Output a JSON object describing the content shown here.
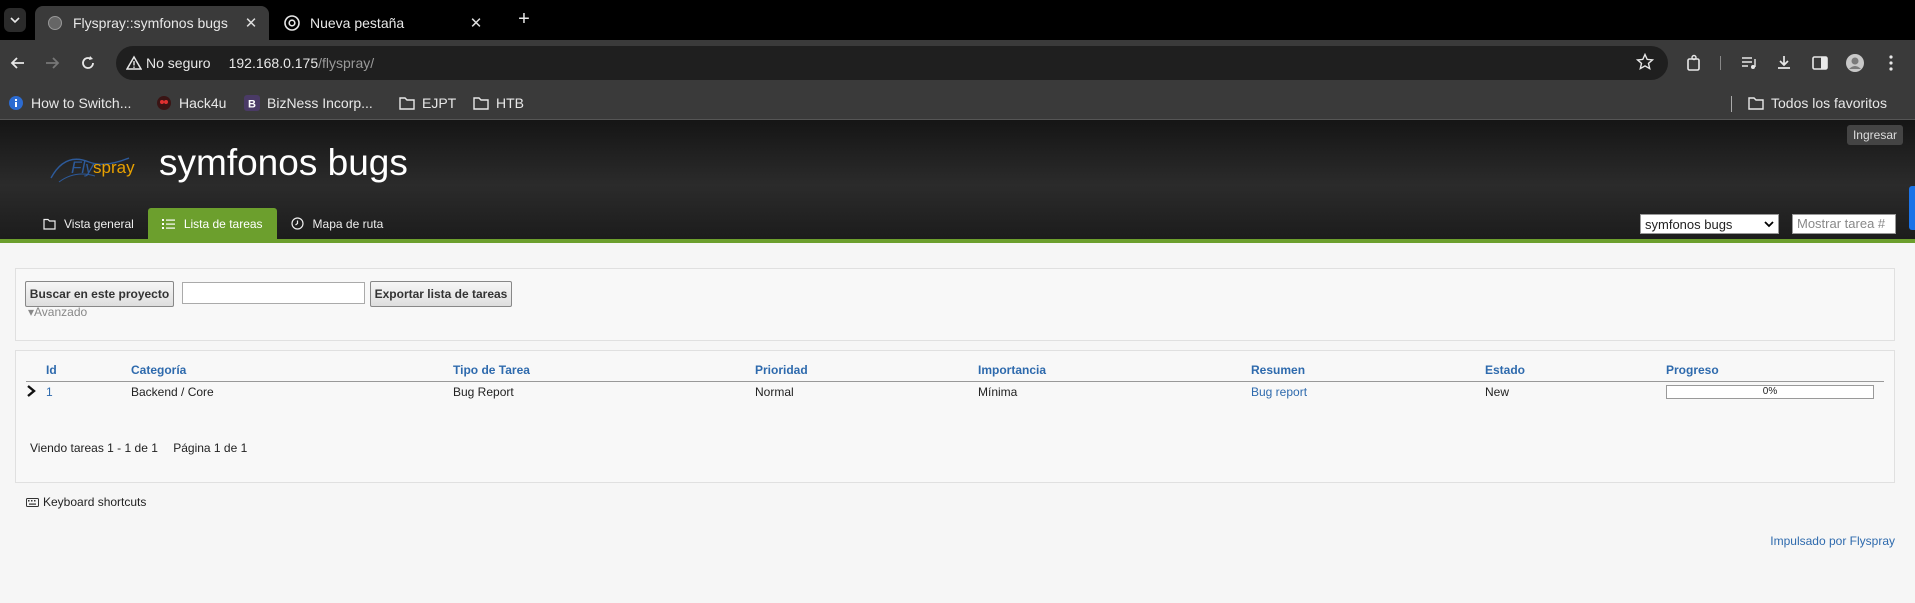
{
  "browser": {
    "tabs": [
      {
        "title": "Flyspray::symfonos bugs",
        "active": true
      },
      {
        "title": "Nueva pestaña",
        "active": false
      }
    ],
    "security_label": "No seguro",
    "url_host": "192.168.0.175",
    "url_path": "/flyspray/",
    "bookmarks": [
      {
        "label": "How to Switch...",
        "icon": "info-icon"
      },
      {
        "label": "Hack4u",
        "icon": "hack4u-icon"
      },
      {
        "label": "BizNess Incorp...",
        "icon": "letter-b-icon"
      },
      {
        "label": "EJPT",
        "icon": "folder-icon"
      },
      {
        "label": "HTB",
        "icon": "folder-icon"
      }
    ],
    "all_bookmarks_label": "Todos los favoritos"
  },
  "header": {
    "logo_text_fly": "Fly",
    "logo_text_spray": "spray",
    "project_title": "symfonos bugs",
    "login_label": "Ingresar",
    "nav_tabs": [
      {
        "label": "Vista general",
        "icon": "folder-icon",
        "active": false
      },
      {
        "label": "Lista de tareas",
        "icon": "list-icon",
        "active": true
      },
      {
        "label": "Mapa de ruta",
        "icon": "clock-icon",
        "active": false
      }
    ],
    "project_select_value": "symfonos bugs",
    "show_task_placeholder": "Mostrar tarea #"
  },
  "search": {
    "search_button_label": "Buscar en este proyecto",
    "search_value": "",
    "export_button_label": "Exportar lista de tareas",
    "advanced_label": "▾Avanzado"
  },
  "tasks": {
    "columns": [
      "Id",
      "Categoría",
      "Tipo de Tarea",
      "Prioridad",
      "Importancia",
      "Resumen",
      "Estado",
      "Progreso"
    ],
    "rows": [
      {
        "id": "1",
        "category": "Backend / Core",
        "type": "Bug Report",
        "priority": "Normal",
        "severity": "Mínima",
        "summary": "Bug report",
        "status": "New",
        "progress_label": "0%",
        "progress_fraction": 0
      }
    ],
    "viewing_text": "Viendo tareas 1 - 1 de 1",
    "page_text": "Página 1 de 1"
  },
  "footer": {
    "keyboard_shortcuts_label": "Keyboard shortcuts",
    "powered_by": "Impulsado por Flyspray"
  },
  "colors": {
    "accent_green": "#6c9f2d",
    "link_blue": "#2e6aad"
  }
}
